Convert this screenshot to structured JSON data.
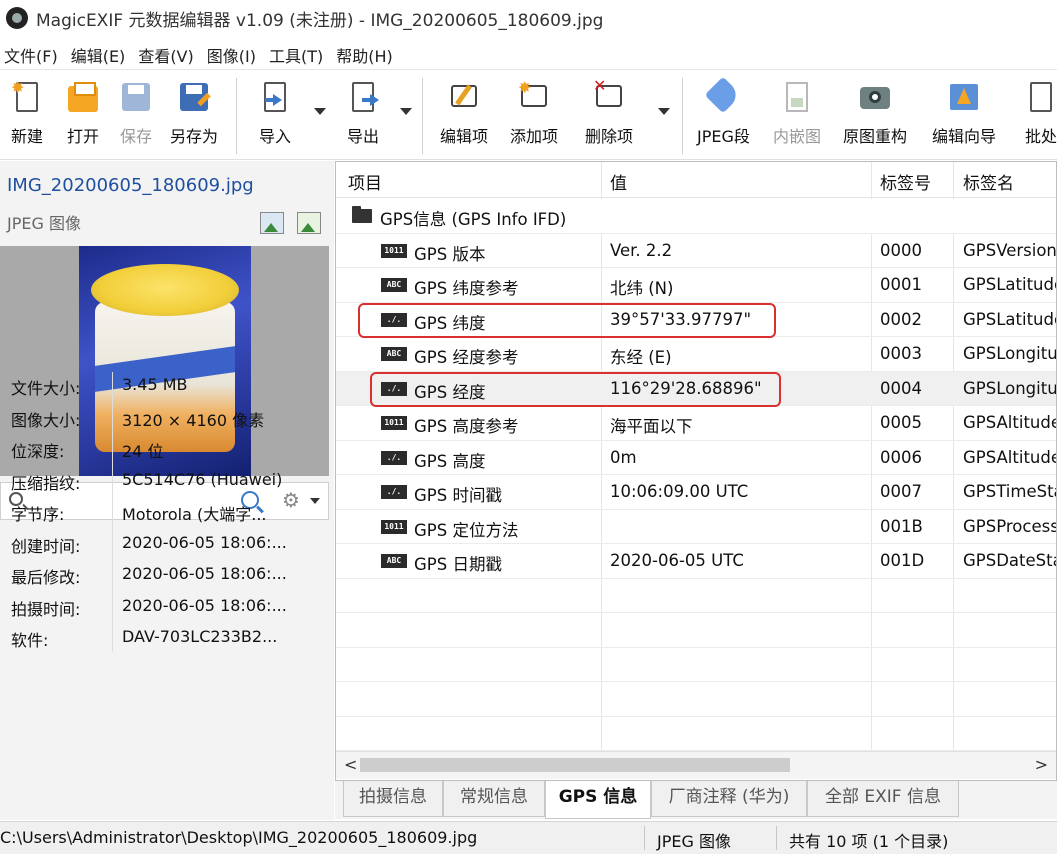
{
  "window": {
    "title": "MagicEXIF 元数据编辑器 v1.09 (未注册) - IMG_20200605_180609.jpg"
  },
  "menu": [
    "文件(F)",
    "编辑(E)",
    "查看(V)",
    "图像(I)",
    "工具(T)",
    "帮助(H)"
  ],
  "toolbar": {
    "new": "新建",
    "open": "打开",
    "save": "保存",
    "save_as": "另存为",
    "import": "导入",
    "export": "导出",
    "edit_item": "编辑项",
    "add_item": "添加项",
    "delete_item": "删除项",
    "jpeg_segment": "JPEG段",
    "embedded_image": "内嵌图",
    "rebuild": "原图重构",
    "wizard": "编辑向导",
    "batch": "批处"
  },
  "file": {
    "name": "IMG_20200605_180609.jpg",
    "type": "JPEG 图像",
    "properties": [
      {
        "key": "文件大小:",
        "value": "3.45 MB"
      },
      {
        "key": "图像大小:",
        "value": "3120 × 4160 像素"
      },
      {
        "key": "位深度:",
        "value": "24 位"
      },
      {
        "key": "压缩指纹:",
        "value": "5C514C76 (Huawei)"
      },
      {
        "key": "字节序:",
        "value": "Motorola (大端字..."
      },
      {
        "key": "创建时间:",
        "value": "2020-06-05 18:06:..."
      },
      {
        "key": "最后修改:",
        "value": "2020-06-05 18:06:..."
      },
      {
        "key": "拍摄时间:",
        "value": "2020-06-05 18:06:..."
      },
      {
        "key": "软件:",
        "value": "DAV-703LC233B2..."
      }
    ]
  },
  "search": {
    "placeholder": ""
  },
  "table": {
    "headers": {
      "item": "项目",
      "value": "值",
      "tag_id": "标签号",
      "tag_name": "标签名"
    },
    "group": "GPS信息 (GPS Info IFD)",
    "rows": [
      {
        "icon": "1011",
        "name": "GPS 版本",
        "value": "Ver. 2.2",
        "tag": "0000",
        "tag_name": "GPSVersionID"
      },
      {
        "icon": "ABC",
        "name": "GPS 纬度参考",
        "value": "北纬 (N)",
        "tag": "0001",
        "tag_name": "GPSLatitudeRef"
      },
      {
        "icon": "./.",
        "name": "GPS 纬度",
        "value": "39°57'33.97797\"",
        "tag": "0002",
        "tag_name": "GPSLatitude"
      },
      {
        "icon": "ABC",
        "name": "GPS 经度参考",
        "value": "东经 (E)",
        "tag": "0003",
        "tag_name": "GPSLongitudeRef"
      },
      {
        "icon": "./.",
        "name": "GPS 经度",
        "value": "116°29'28.68896\"",
        "tag": "0004",
        "tag_name": "GPSLongitude"
      },
      {
        "icon": "1011",
        "name": "GPS 高度参考",
        "value": "海平面以下",
        "tag": "0005",
        "tag_name": "GPSAltitudeRef"
      },
      {
        "icon": "./.",
        "name": "GPS 高度",
        "value": "0m",
        "tag": "0006",
        "tag_name": "GPSAltitude"
      },
      {
        "icon": "./.",
        "name": "GPS 时间戳",
        "value": "10:06:09.00 UTC",
        "tag": "0007",
        "tag_name": "GPSTimeStamp"
      },
      {
        "icon": "1011",
        "name": "GPS 定位方法",
        "value": "",
        "tag": "001B",
        "tag_name": "GPSProcessingMethod"
      },
      {
        "icon": "ABC",
        "name": "GPS 日期戳",
        "value": "2020-06-05 UTC",
        "tag": "001D",
        "tag_name": "GPSDateStamp"
      }
    ],
    "scroll_left": "<",
    "scroll_right": ">"
  },
  "tabs": [
    "拍摄信息",
    "常规信息",
    "GPS 信息",
    "厂商注释 (华为)",
    "全部 EXIF 信息"
  ],
  "active_tab": "GPS 信息",
  "status": {
    "path": "C:\\Users\\Administrator\\Desktop\\IMG_20200605_180609.jpg",
    "type": "JPEG 图像",
    "count": "共有 10 项 (1 个目录)"
  },
  "colors": {
    "highlight_box": "#d93030",
    "file_name": "#1f4f9e"
  }
}
